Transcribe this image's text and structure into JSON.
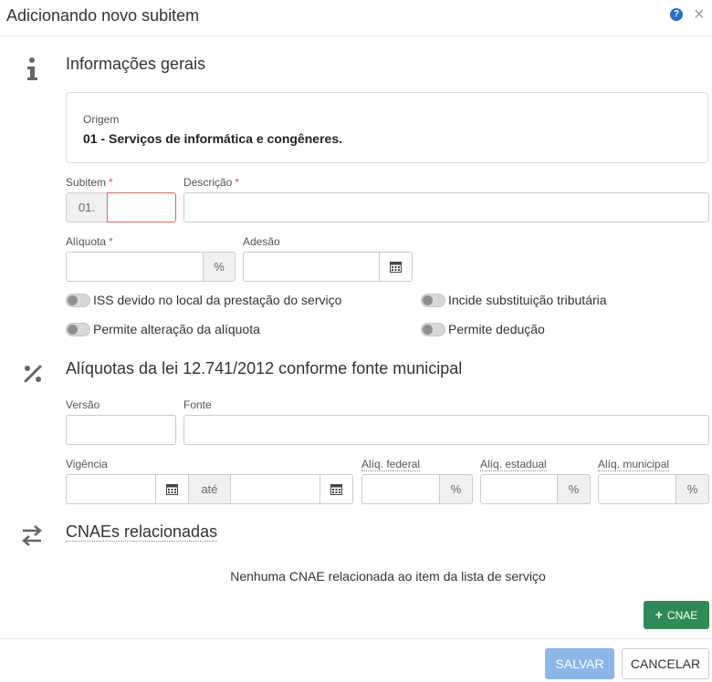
{
  "dialog": {
    "title": "Adicionando novo subitem",
    "help_icon": "?",
    "close_icon": "×"
  },
  "general": {
    "section_title": "Informações gerais",
    "origin_label": "Origem",
    "origin_value": "01 - Serviços de informática e congêneres.",
    "subitem_label": "Subitem",
    "subitem_prefix": "01.",
    "subitem_value": "",
    "description_label": "Descrição",
    "description_value": "",
    "aliquota_label": "Alíquota",
    "aliquota_value": "",
    "percent_sign": "%",
    "adesao_label": "Adesão",
    "adesao_value": "",
    "toggles": [
      {
        "label": "ISS devido no local da prestação do serviço",
        "checked": false
      },
      {
        "label": "Incide substituição tributária",
        "checked": false
      },
      {
        "label": "Permite alteração da alíquota",
        "checked": false
      },
      {
        "label": "Permite dedução",
        "checked": false
      }
    ]
  },
  "rates": {
    "section_title": "Alíquotas da lei 12.741/2012 conforme fonte municipal",
    "versao_label": "Versão",
    "fonte_label": "Fonte",
    "vigencia_label": "Vigência",
    "ate_label": "até",
    "federal_label": "Alíq. federal",
    "estadual_label": "Alíq. estadual",
    "municipal_label": "Alíq. municipal",
    "percent_sign": "%"
  },
  "cnae": {
    "section_title": "CNAEs relacionadas",
    "empty_message": "Nenhuma CNAE relacionada ao item da lista de serviço",
    "add_button": "CNAE",
    "add_button_plus": "+"
  },
  "footer": {
    "save_label": "SALVAR",
    "cancel_label": "CANCELAR"
  },
  "colors": {
    "primary": "#2a6fc9",
    "success": "#2e8b57",
    "save_disabled": "#8ab6ea",
    "required": "#d9534f"
  },
  "icons": {
    "info": "info-icon",
    "percent": "percent-icon",
    "exchange": "exchange-arrows-icon",
    "calendar": "calendar-icon"
  }
}
